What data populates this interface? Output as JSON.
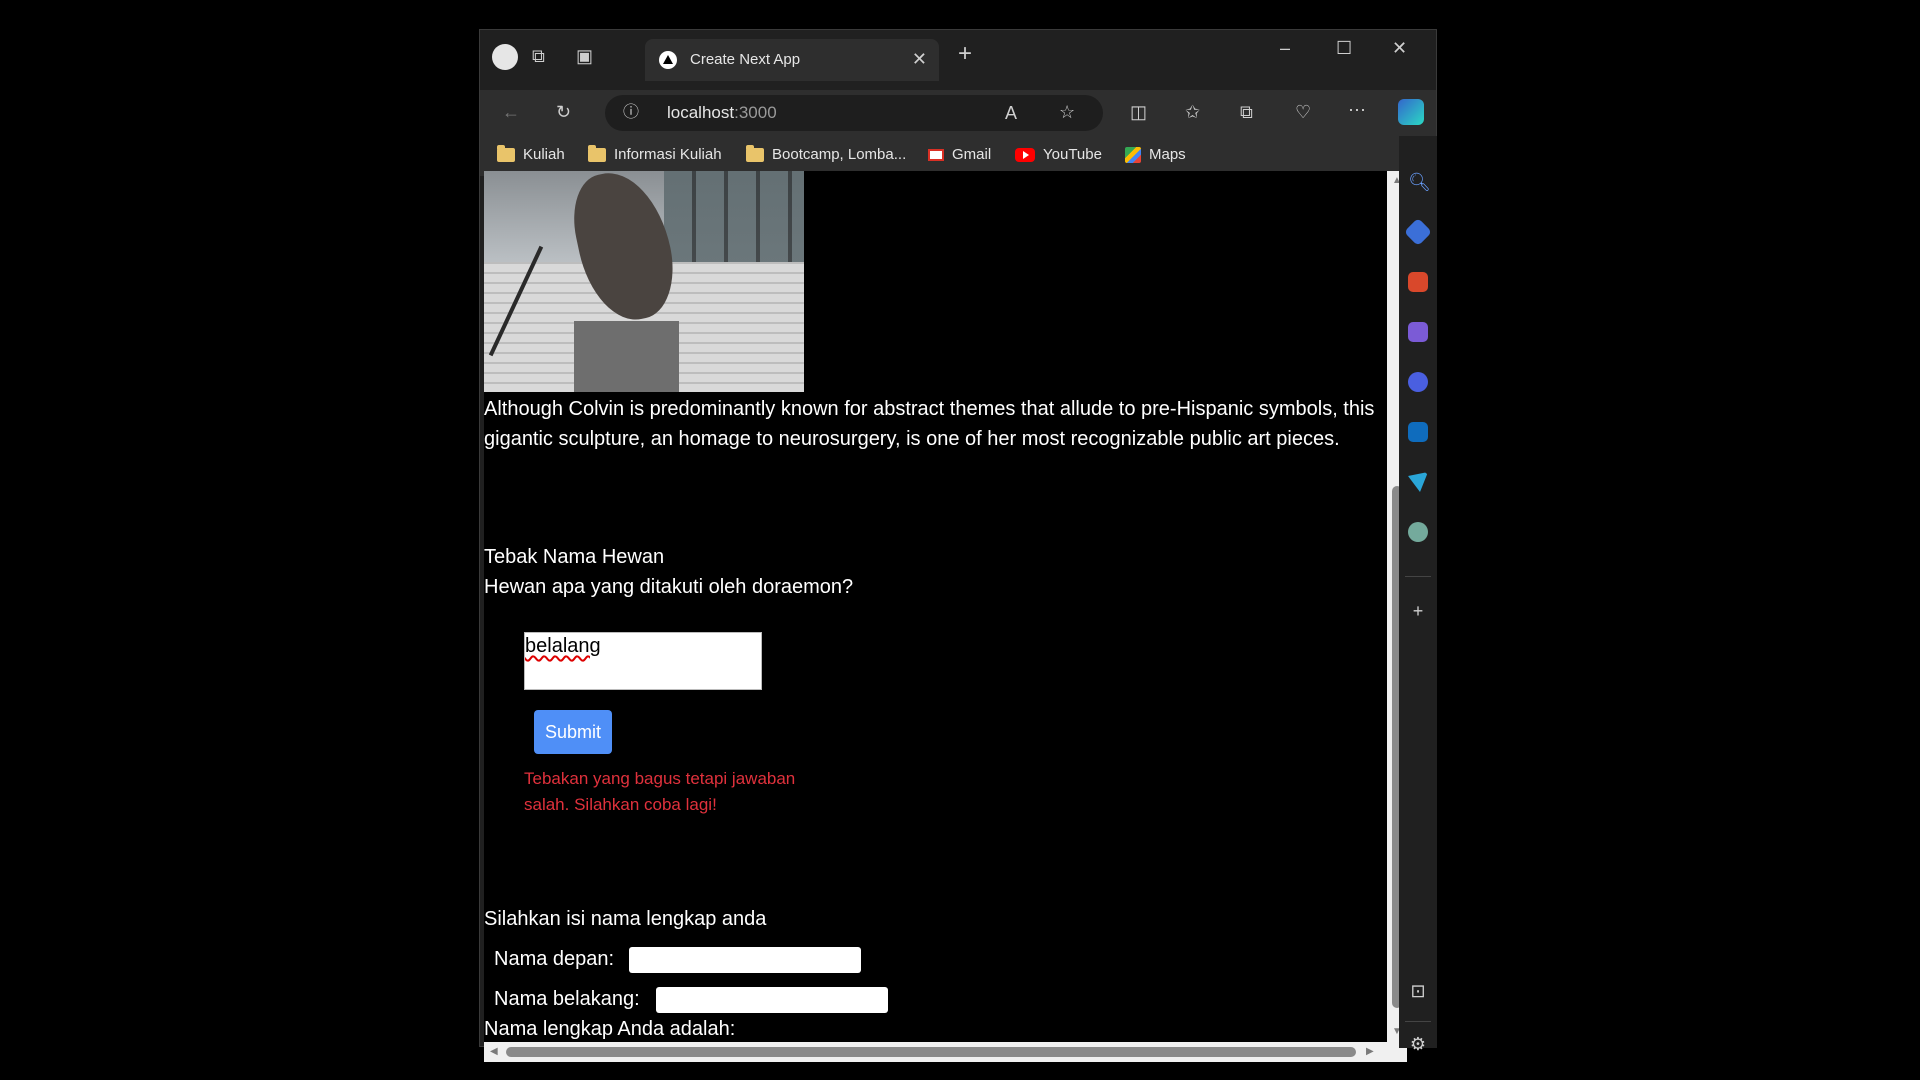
{
  "tab": {
    "title": "Create Next App"
  },
  "address": {
    "host": "localhost",
    "port": ":3000"
  },
  "bookmarks": [
    {
      "label": "Kuliah",
      "icon": "folder-icon"
    },
    {
      "label": "Informasi Kuliah",
      "icon": "folder-icon"
    },
    {
      "label": "Bootcamp, Lomba...",
      "icon": "folder-icon"
    },
    {
      "label": "Gmail",
      "icon": "gmail-icon"
    },
    {
      "label": "YouTube",
      "icon": "youtube-icon"
    },
    {
      "label": "Maps",
      "icon": "maps-icon"
    }
  ],
  "content": {
    "paragraph": "Although Colvin is predominantly known for abstract themes that allude to pre-Hispanic symbols, this gigantic sculpture, an homage to neurosurgery, is one of her most recognizable public art pieces.",
    "quiz": {
      "title": "Tebak Nama Hewan",
      "question": "Hewan apa yang ditakuti oleh doraemon?",
      "answer": "belalang",
      "submit_label": "Submit",
      "feedback": "Tebakan yang bagus tetapi jawaban salah. Silahkan coba lagi!",
      "feedback_color": "#e0313c"
    },
    "form": {
      "heading": "Silahkan isi nama lengkap anda",
      "first_name_label": "Nama depan:",
      "first_name_value": "",
      "last_name_label": "Nama belakang:",
      "last_name_value": "",
      "result_label": "Nama lengkap Anda adalah:"
    }
  },
  "colors": {
    "accent": "#4f8ff7",
    "background": "#000000"
  }
}
